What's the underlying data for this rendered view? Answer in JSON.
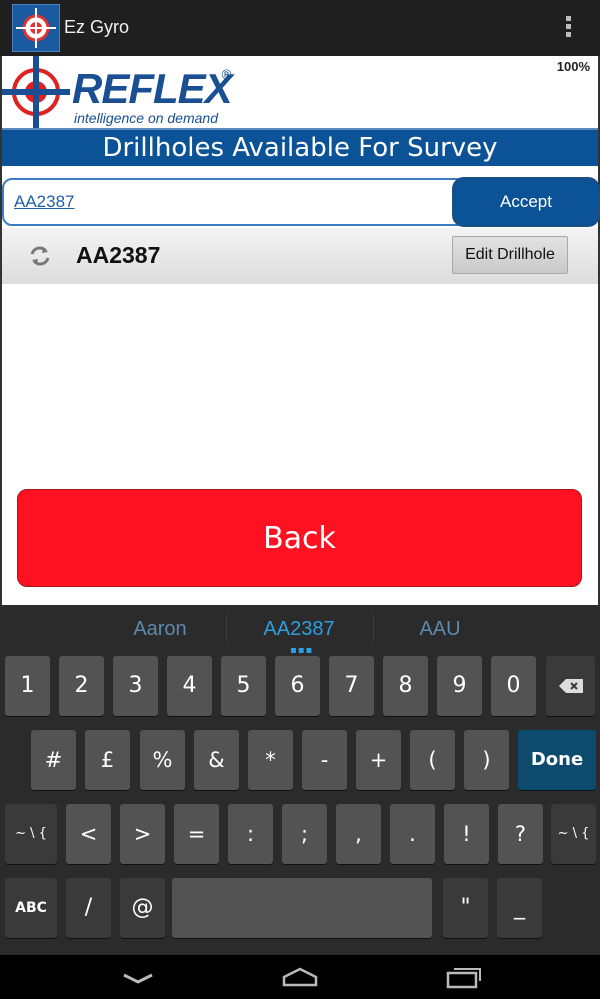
{
  "app": {
    "title": "Ez Gyro"
  },
  "status": {
    "battery": "100%"
  },
  "logo": {
    "word": "REFLEX",
    "reg": "®",
    "tagline": "intelligence on demand"
  },
  "page": {
    "title": "Drillholes Available For Survey"
  },
  "search": {
    "value": "AA2387",
    "accept_label": "Accept"
  },
  "drillholes": [
    {
      "name": "AA2387",
      "edit_label": "Edit Drillhole"
    }
  ],
  "back_label": "Back",
  "keyboard": {
    "suggestions": [
      "Aaron",
      "AA2387",
      "AAU"
    ],
    "row1": [
      "1",
      "2",
      "3",
      "4",
      "5",
      "6",
      "7",
      "8",
      "9",
      "0"
    ],
    "row2": [
      "#",
      "£",
      "%",
      "&",
      "*",
      "-",
      "+",
      "(",
      ")"
    ],
    "done_label": "Done",
    "row3": [
      "~ \\ {",
      "<",
      ">",
      "=",
      ":",
      ";",
      ",",
      ".",
      "!",
      "?",
      "~ \\ {"
    ],
    "row4": [
      "ABC",
      "/",
      "@",
      "\"",
      "_"
    ]
  },
  "colors": {
    "brand_blue": "#0b5396",
    "back_red": "#ff1121",
    "suggest_blue": "#2b9fe0"
  }
}
